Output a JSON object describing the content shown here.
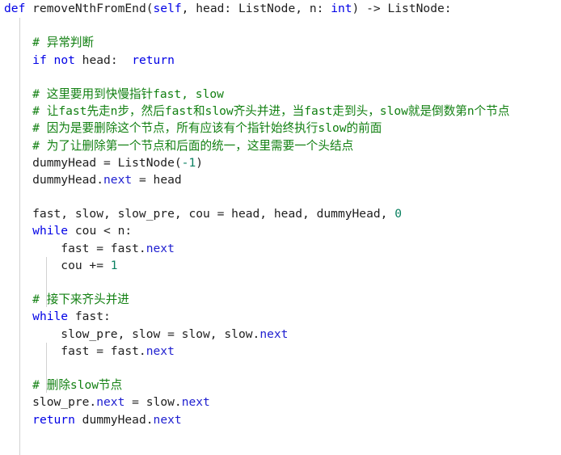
{
  "editor": {
    "language": "python",
    "background_color": "#ffffff",
    "colors": {
      "keyword": "#0000e6",
      "comment": "#128012",
      "attribute": "#2020d0",
      "number": "#0a8060",
      "plain": "#202020",
      "indent_guide": "#d2d2d2"
    }
  },
  "code": {
    "lines": [
      {
        "n": 1,
        "text": "def removeNthFromEnd(self, head: ListNode, n: int) -> ListNode:",
        "tokens": [
          {
            "t": "def",
            "c": "kw"
          },
          {
            "t": " removeNthFromEnd(",
            "c": "pln"
          },
          {
            "t": "self",
            "c": "kw"
          },
          {
            "t": ", head: ListNode, n: ",
            "c": "pln"
          },
          {
            "t": "int",
            "c": "kw"
          },
          {
            "t": ") -> ListNode:",
            "c": "pln"
          }
        ]
      },
      {
        "n": 2,
        "text": "",
        "tokens": []
      },
      {
        "n": 3,
        "text": "    # 异常判断",
        "tokens": [
          {
            "t": "    ",
            "c": "pln"
          },
          {
            "t": "# 异常判断",
            "c": "com"
          }
        ]
      },
      {
        "n": 4,
        "text": "    if not head:  return",
        "tokens": [
          {
            "t": "    ",
            "c": "pln"
          },
          {
            "t": "if",
            "c": "kw"
          },
          {
            "t": " ",
            "c": "pln"
          },
          {
            "t": "not",
            "c": "kw"
          },
          {
            "t": " head:  ",
            "c": "pln"
          },
          {
            "t": "return",
            "c": "kw"
          }
        ]
      },
      {
        "n": 5,
        "text": "",
        "tokens": []
      },
      {
        "n": 6,
        "text": "    # 这里要用到快慢指针fast, slow",
        "tokens": [
          {
            "t": "    ",
            "c": "pln"
          },
          {
            "t": "# 这里要用到快慢指针fast, slow",
            "c": "com"
          }
        ]
      },
      {
        "n": 7,
        "text": "    # 让fast先走n步，然后fast和slow齐头并进，当fast走到头，slow就是倒数第n个节点",
        "tokens": [
          {
            "t": "    ",
            "c": "pln"
          },
          {
            "t": "# 让fast先走n步，然后fast和slow齐头并进，当fast走到头，slow就是倒数第n个节点",
            "c": "com"
          }
        ]
      },
      {
        "n": 8,
        "text": "    # 因为是要删除这个节点，所有应该有个指针始终执行slow的前面",
        "tokens": [
          {
            "t": "    ",
            "c": "pln"
          },
          {
            "t": "# 因为是要删除这个节点，所有应该有个指针始终执行slow的前面",
            "c": "com"
          }
        ]
      },
      {
        "n": 9,
        "text": "    # 为了让删除第一个节点和后面的统一，这里需要一个头结点",
        "tokens": [
          {
            "t": "    ",
            "c": "pln"
          },
          {
            "t": "# 为了让删除第一个节点和后面的统一，这里需要一个头结点",
            "c": "com"
          }
        ]
      },
      {
        "n": 10,
        "text": "    dummyHead = ListNode(-1)",
        "tokens": [
          {
            "t": "    dummyHead = ListNode(",
            "c": "pln"
          },
          {
            "t": "-1",
            "c": "num"
          },
          {
            "t": ")",
            "c": "pln"
          }
        ]
      },
      {
        "n": 11,
        "text": "    dummyHead.next = head",
        "tokens": [
          {
            "t": "    dummyHead.",
            "c": "pln"
          },
          {
            "t": "next",
            "c": "attr"
          },
          {
            "t": " = head",
            "c": "pln"
          }
        ]
      },
      {
        "n": 12,
        "text": "",
        "tokens": []
      },
      {
        "n": 13,
        "text": "    fast, slow, slow_pre, cou = head, head, dummyHead, 0",
        "tokens": [
          {
            "t": "    fast, slow, slow_pre, cou = head, head, dummyHead, ",
            "c": "pln"
          },
          {
            "t": "0",
            "c": "num"
          }
        ]
      },
      {
        "n": 14,
        "text": "    while cou < n:",
        "tokens": [
          {
            "t": "    ",
            "c": "pln"
          },
          {
            "t": "while",
            "c": "kw"
          },
          {
            "t": " cou < n:",
            "c": "pln"
          }
        ]
      },
      {
        "n": 15,
        "text": "        fast = fast.next",
        "tokens": [
          {
            "t": "        fast = fast.",
            "c": "pln"
          },
          {
            "t": "next",
            "c": "attr"
          }
        ]
      },
      {
        "n": 16,
        "text": "        cou += 1",
        "tokens": [
          {
            "t": "        cou += ",
            "c": "pln"
          },
          {
            "t": "1",
            "c": "num"
          }
        ]
      },
      {
        "n": 17,
        "text": "",
        "tokens": []
      },
      {
        "n": 18,
        "text": "    # 接下来齐头并进",
        "tokens": [
          {
            "t": "    ",
            "c": "pln"
          },
          {
            "t": "# 接下来齐头并进",
            "c": "com"
          }
        ]
      },
      {
        "n": 19,
        "text": "    while fast:",
        "tokens": [
          {
            "t": "    ",
            "c": "pln"
          },
          {
            "t": "while",
            "c": "kw"
          },
          {
            "t": " fast:",
            "c": "pln"
          }
        ]
      },
      {
        "n": 20,
        "text": "        slow_pre, slow = slow, slow.next",
        "tokens": [
          {
            "t": "        slow_pre, slow = slow, slow.",
            "c": "pln"
          },
          {
            "t": "next",
            "c": "attr"
          }
        ]
      },
      {
        "n": 21,
        "text": "        fast = fast.next",
        "tokens": [
          {
            "t": "        fast = fast.",
            "c": "pln"
          },
          {
            "t": "next",
            "c": "attr"
          }
        ]
      },
      {
        "n": 22,
        "text": "",
        "tokens": []
      },
      {
        "n": 23,
        "text": "    # 删除slow节点",
        "tokens": [
          {
            "t": "    ",
            "c": "pln"
          },
          {
            "t": "# 删除slow节点",
            "c": "com"
          }
        ]
      },
      {
        "n": 24,
        "text": "    slow_pre.next = slow.next",
        "tokens": [
          {
            "t": "    slow_pre.",
            "c": "pln"
          },
          {
            "t": "next",
            "c": "attr"
          },
          {
            "t": " = slow.",
            "c": "pln"
          },
          {
            "t": "next",
            "c": "attr"
          }
        ]
      },
      {
        "n": 25,
        "text": "    return dummyHead.next",
        "tokens": [
          {
            "t": "    ",
            "c": "pln"
          },
          {
            "t": "return",
            "c": "kw"
          },
          {
            "t": " dummyHead.",
            "c": "pln"
          },
          {
            "t": "next",
            "c": "attr"
          }
        ]
      }
    ]
  }
}
